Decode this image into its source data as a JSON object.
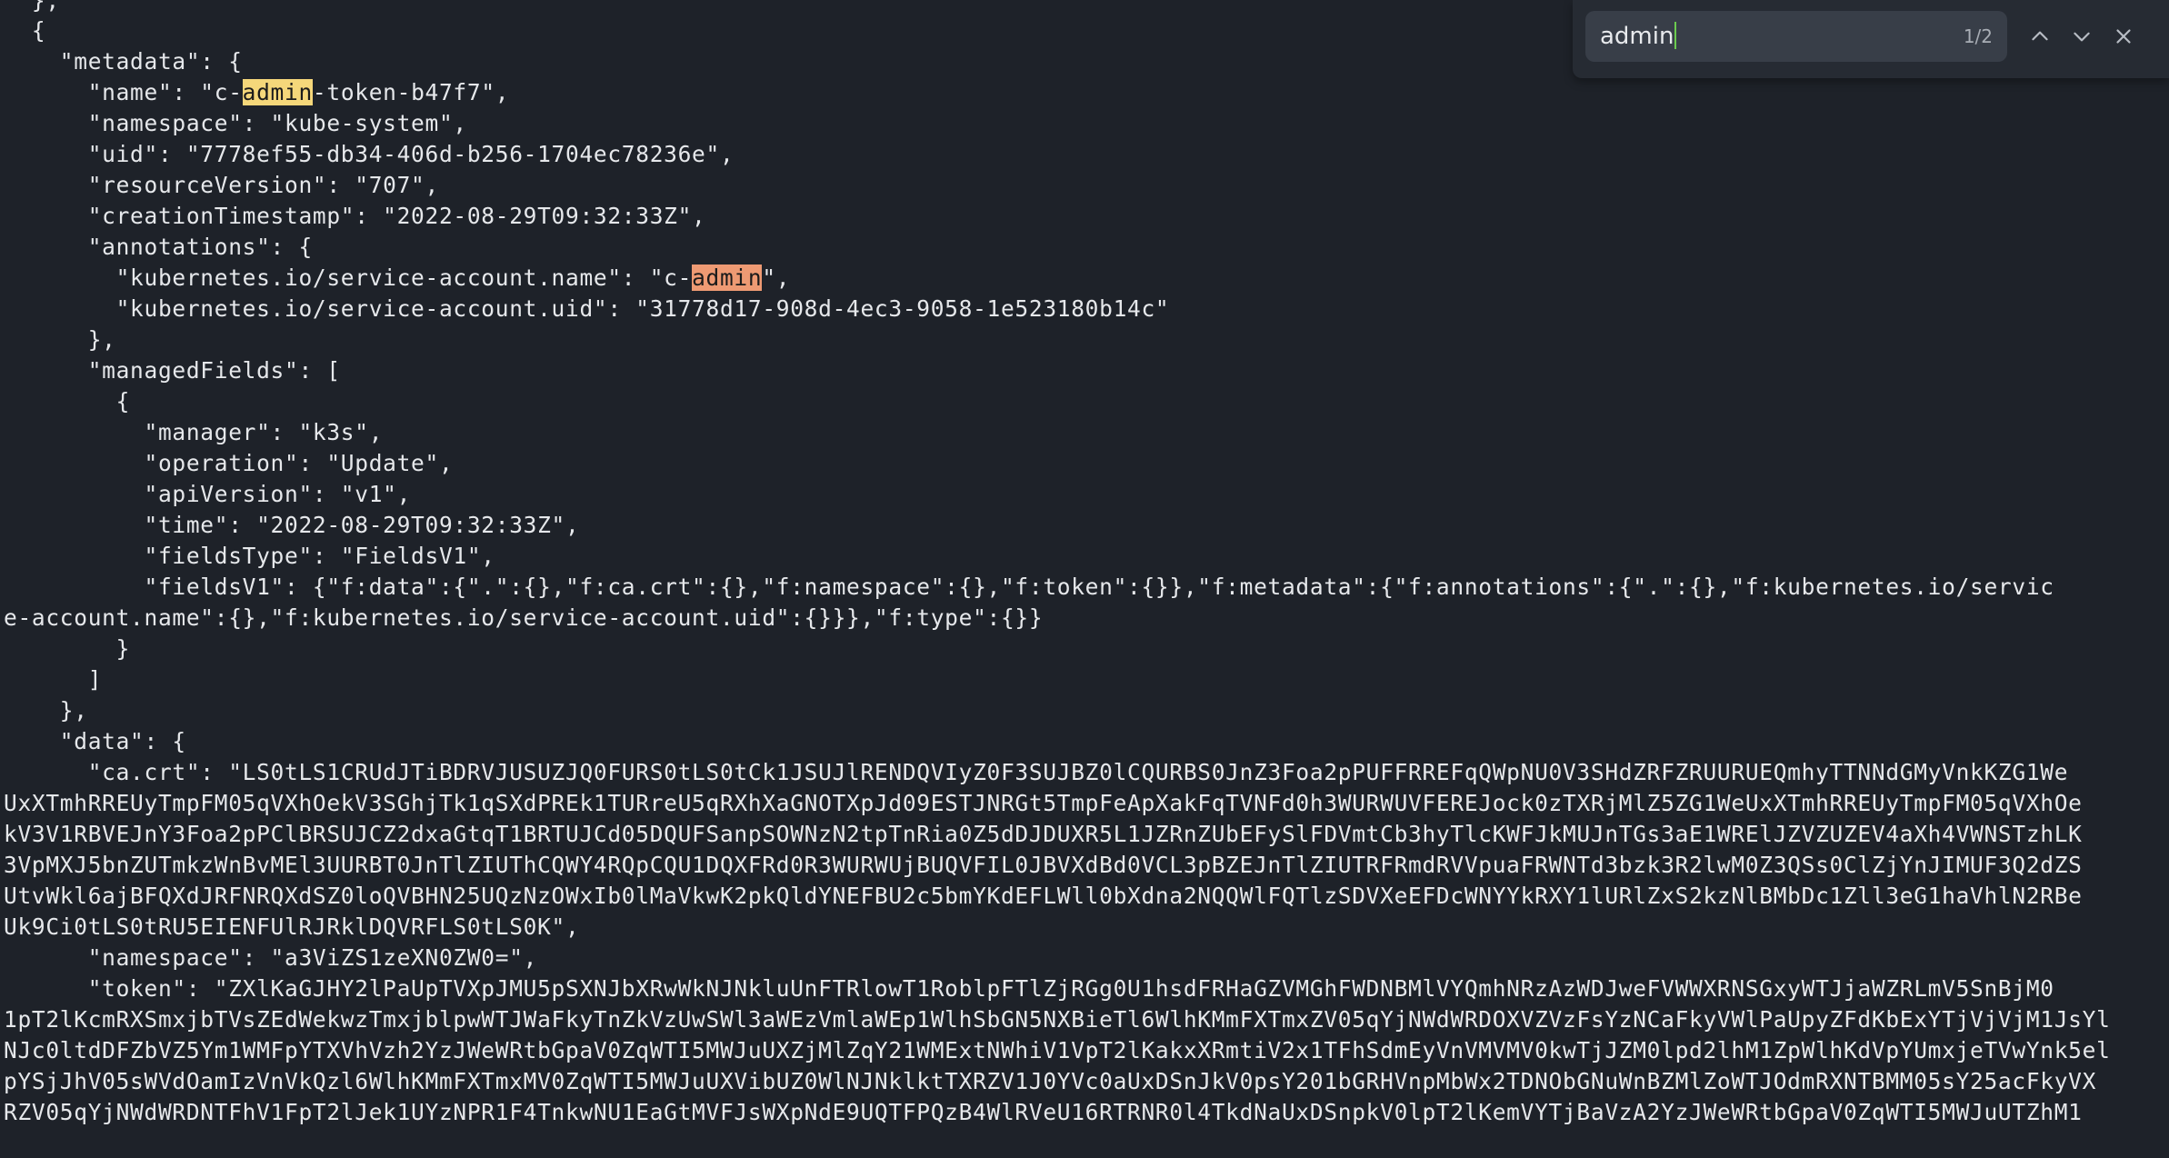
{
  "find_bar": {
    "query": "admin",
    "match_count": "1/2",
    "prev_icon": "chevron-up-icon",
    "next_icon": "chevron-down-icon",
    "close_icon": "close-icon"
  },
  "terminal_lines": [
    "  },",
    "  {",
    "    \"metadata\": {",
    "      \"name\": \"c-",
    "admin",
    "-token-b47f7\",",
    "      \"namespace\": \"kube-system\",",
    "      \"uid\": \"7778ef55-db34-406d-b256-1704ec78236e\",",
    "      \"resourceVersion\": \"707\",",
    "      \"creationTimestamp\": \"2022-08-29T09:32:33Z\",",
    "      \"annotations\": {",
    "        \"kubernetes.io/service-account.name\": \"c-",
    "admin",
    "\",",
    "        \"kubernetes.io/service-account.uid\": \"31778d17-908d-4ec3-9058-1e523180b14c\"",
    "      },",
    "      \"managedFields\": [",
    "        {",
    "          \"manager\": \"k3s\",",
    "          \"operation\": \"Update\",",
    "          \"apiVersion\": \"v1\",",
    "          \"time\": \"2022-08-29T09:32:33Z\",",
    "          \"fieldsType\": \"FieldsV1\",",
    "          \"fieldsV1\": {\"f:data\":{\".\":{},\"f:ca.crt\":{},\"f:namespace\":{},\"f:token\":{}},\"f:metadata\":{\"f:annotations\":{\".\":{},\"f:kubernetes.io/servic",
    "e-account.name\":{},\"f:kubernetes.io/service-account.uid\":{}}},\"f:type\":{}}",
    "        }",
    "      ]",
    "    },",
    "    \"data\": {",
    "      \"ca.crt\": \"LS0tLS1CRUdJTiBDRVJUSUZJQ0FURS0tLS0tCk1JSUJlRENDQVIyZ0F3SUJBZ0lCQURBS0JnZ3Foa2pPUFFRREFqQWpNU0V3SHdZRFZRUURUEQmhyTTNNdGMyVnkKZG1We",
    "UxXTmhRREUyTmpFM05qVXhOekV3SGhjTk1qSXdPREk1TURreU5qRXhXaGNOTXpJd09ESTJNRGt5TmpFeApXakFqTVNFd0h3WURWUVFEREJock0zTXRjMlZ5ZG1WeUxXTmhRREUyTmpFM05qVXhOe",
    "kV3V1RBVEJnY3Foa2pPClBRSUJCZ2dxaGtqT1BRTUJCd05DQUFSanpSOWNzN2tpTnRia0Z5dDJDUXR5L1JZRnZUbEFySlFDVmtCb3hyTlcKWFJkMUJnTGs3aE1WRElJZVZUZEV4aXh4VWNSTzhLK",
    "3VpMXJ5bnZUTmkzWnBvMEl3UURBT0JnTlZIUThCQWY4RQpCQU1DQXFRd0R3WURWUjBUQVFIL0JBVXdBd0VCL3pBZEJnTlZIUTRFRmdRVVpuaFRWNTd3bzk3R2lwM0Z3QSs0ClZjYnJIMUF3Q2dZS",
    "UtvWkl6ajBFQXdJRFNRQXdSZ0loQVBHN25UQzNzOWxIb0lMaVkwK2pkQldYNEFBU2c5bmYKdEFLWll0bXdna2NQQWlFQTlzSDVXeEFDcWNYYkRXY1lURlZxS2kzNlBMbDc1Zll3eG1haVhlN2RBe",
    "Uk9Ci0tLS0tRU5EIENFUlRJRklDQVRFLS0tLS0K\",",
    "      \"namespace\": \"a3ViZS1zeXN0ZW0=\",",
    "      \"token\": \"ZXlKaGJHY2lPaUpTVXpJMU5pSXNJbXRwWkNJNkluUnFTRlowT1RoblpFTlZjRGg0U1hsdFRHaGZVMGhFWDNBMlVYQmhNRzAzWDJweFVWWXRNSGxyWTJjaWZRLmV5SnBjM0",
    "1pT2lKcmRXSmxjbTVsZEdWekwzTmxjblpwWTJWaFkyTnZkVzUwSWl3aWEzVmlaWEp1WlhSbGN5NXBieTl6WlhKMmFXTmxZV05qYjNWdWRDOXVZVzFsYzNCaFkyVWlPaUpyZFdKbExYTjVjVjM1JsYl",
    "NJc0ltdDFZbVZ5Ym1WMFpYTXVhVzh2YzJWeWRtbGpaV0ZqWTI5MWJuUXZjMlZqY21WMExtNWhiV1VpT2lKakxXRmtiV2x1TFhSdmEyVnVMVMV0kwTjJZM0lpd2lhM1ZpWlhKdVpYUmxjeTVwYnk5el",
    "pYSjJhV05sWVdOamIzVnVkQzl6WlhKMmFXTmxMV0ZqWTI5MWJuUXVibUZ0WlNJNklktTXRZV1J0YVc0aUxDSnJkV0psY201bGRHVnpMbWx2TDNObGNuWnBZMlZoWTJOdmRXNTBMM05sY25acFkyVX",
    "RZV05qYjNWdWRDNTFhV1FpT2lJek1UYzNPR1F4TnkwNU1EaGtMVFJsWXpNdE9UQTFPQzB4WlRVeU16RTRNR0l4TkdNaUxDSnpkV0lpT2lKemVYTjBaVzA2YzJWeWRtbGpaV0ZqWTI5MWJuUTZhM1"
  ]
}
